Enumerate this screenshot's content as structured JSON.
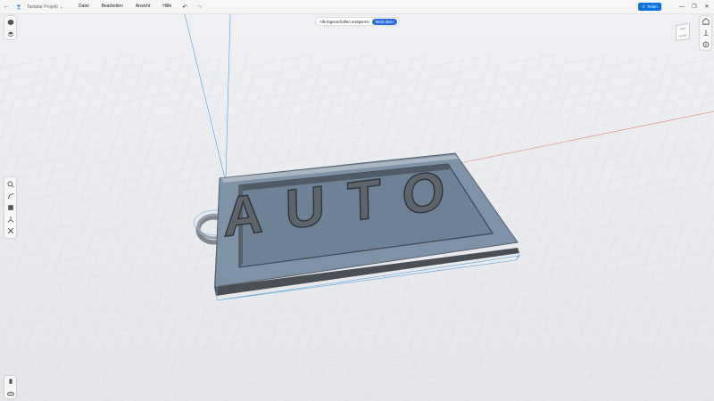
{
  "titlebar": {
    "project_name": "Tastatur Projekt",
    "menu": [
      "Datei",
      "Bearbeiten",
      "Ansicht",
      "Hilfe"
    ],
    "share_label": "Teilen"
  },
  "banner": {
    "text": "Alle Eigenschaften entsperren",
    "link": "Mehr dazu"
  },
  "model": {
    "text": "AUTO"
  },
  "viewcube": {
    "top": "OBEN",
    "front": "VORNE"
  },
  "colors": {
    "accent": "#0b72e0",
    "model_face": "#8a9099",
    "model_selected_tint": "#7fa6c4",
    "grid": "#d3d6db",
    "x_axis": "#e07b6b",
    "y_axis": "#5aa0d8"
  },
  "icons": {
    "left_top": [
      "design-icon",
      "layers-icon"
    ],
    "left_middle": [
      "zoom-icon",
      "sketch-icon",
      "solid-icon",
      "transform-icon",
      "tools-icon"
    ],
    "left_bottom": [
      "object-icon",
      "measure-icon"
    ],
    "right": [
      "home-icon",
      "view-axes-icon",
      "orbit-icon"
    ]
  }
}
